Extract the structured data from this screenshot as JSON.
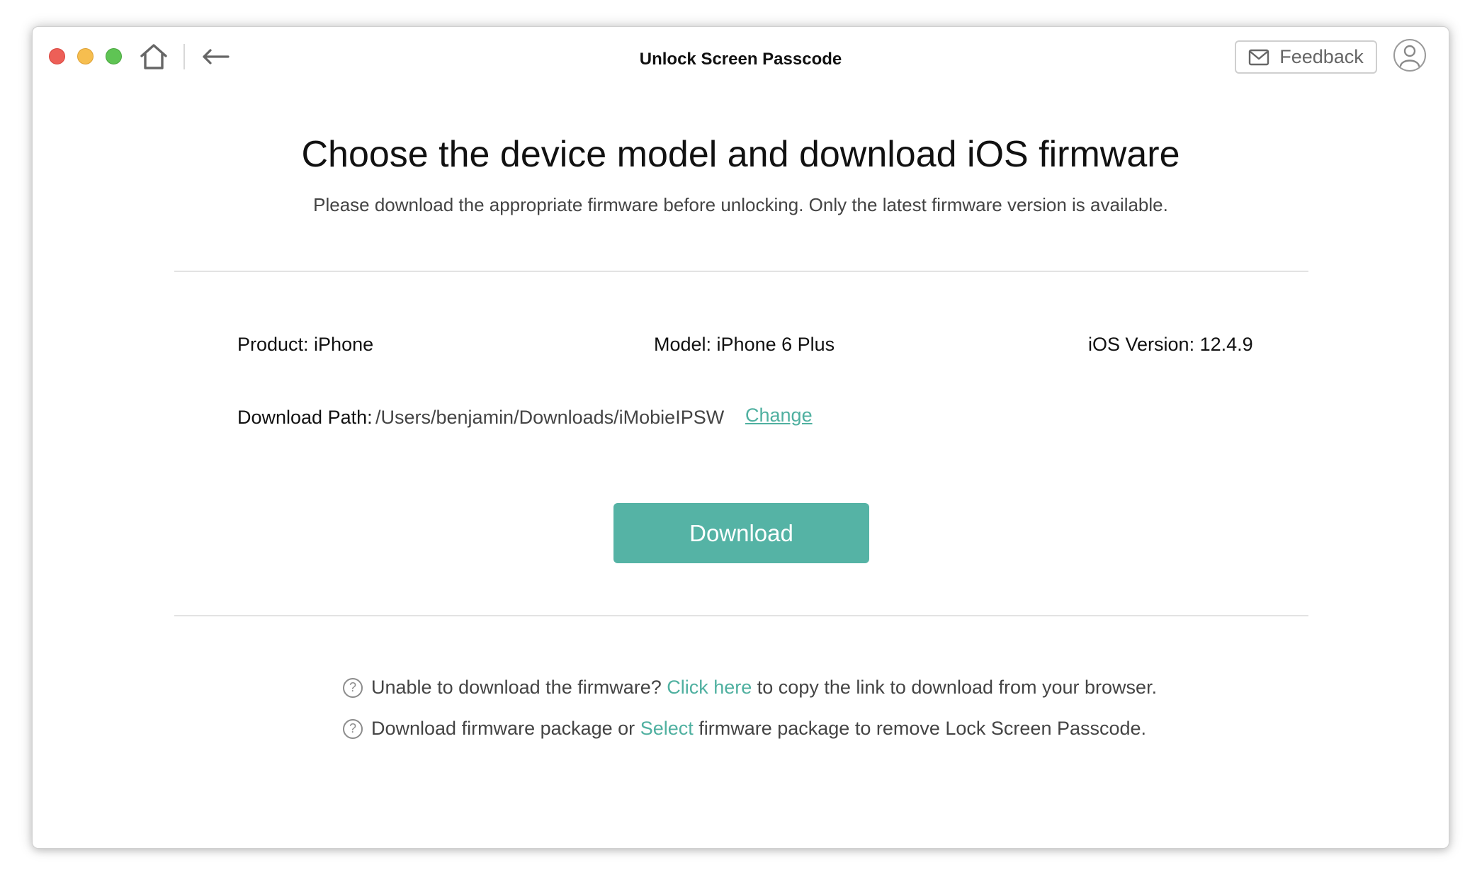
{
  "window": {
    "title": "Unlock Screen Passcode"
  },
  "toolbar": {
    "feedback_label": "Feedback",
    "icons": [
      "home-icon",
      "back-arrow-icon",
      "mail-icon",
      "user-avatar-icon"
    ]
  },
  "main": {
    "heading": "Choose the device model and download iOS firmware",
    "subheading": "Please download the appropriate firmware before unlocking. Only the latest firmware version is available.",
    "product": "Product: iPhone",
    "model": "Model: iPhone 6 Plus",
    "ios_version": "iOS Version: 12.4.9",
    "download_path_label": "Download Path:",
    "download_path_value": "/Users/benjamin/Downloads/iMobieIPSW",
    "change_label": "Change",
    "download_button": "Download"
  },
  "help": {
    "icon_glyph": "?",
    "line1": {
      "before": "Unable to download the firmware? ",
      "link": "Click here",
      "after": " to copy the link to download from your browser."
    },
    "line2": {
      "before": "Download firmware package or ",
      "link": "Select",
      "after": " firmware package to remove Lock Screen Passcode."
    }
  },
  "colors": {
    "accent": "#55b3a5",
    "link": "#4fb0a0",
    "close": "#ed5f57",
    "minimize": "#f6be4f",
    "maximize": "#5fc454"
  }
}
